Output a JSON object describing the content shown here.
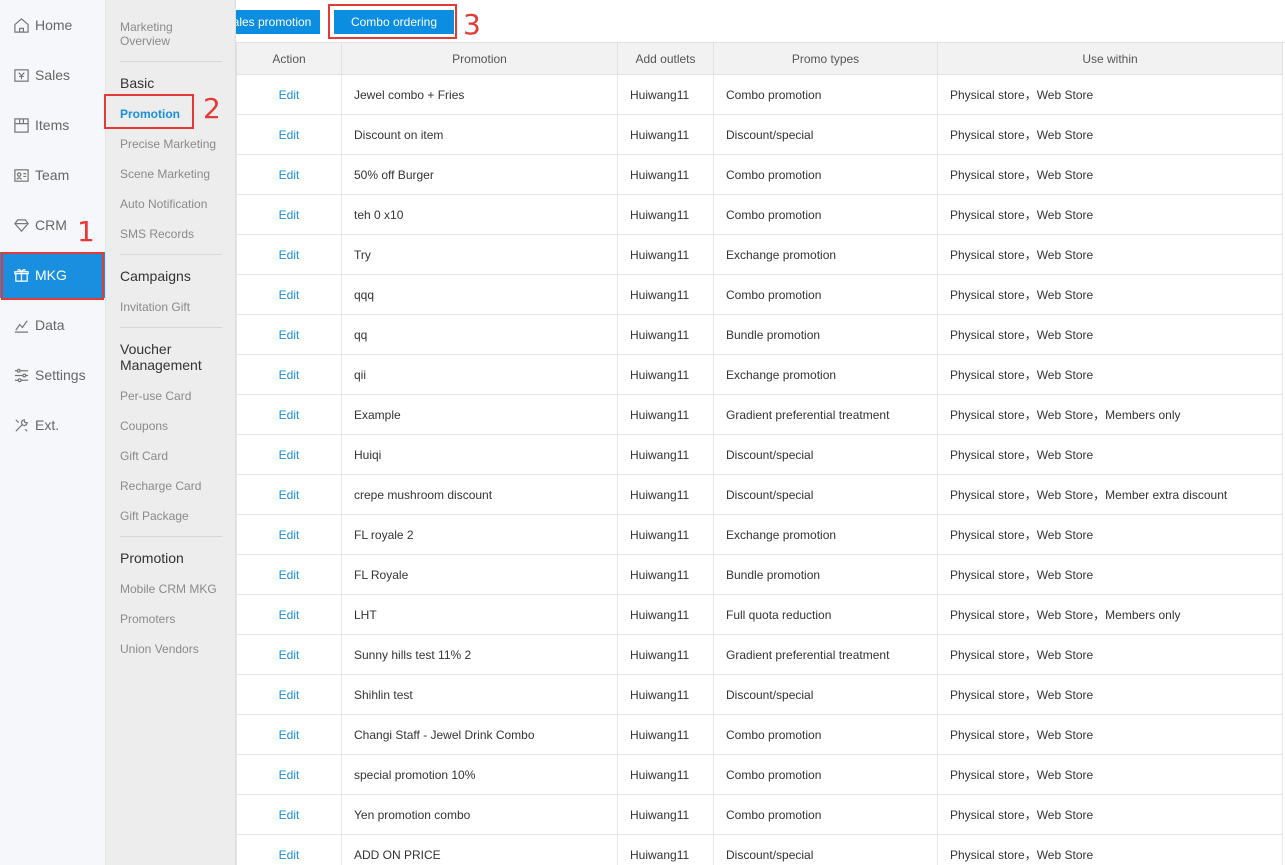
{
  "nav_primary": [
    {
      "label": "Home",
      "icon": "home-icon"
    },
    {
      "label": "Sales",
      "icon": "sales-icon"
    },
    {
      "label": "Items",
      "icon": "items-icon"
    },
    {
      "label": "Team",
      "icon": "team-icon"
    },
    {
      "label": "CRM",
      "icon": "crm-icon"
    },
    {
      "label": "MKG",
      "icon": "mkg-icon",
      "active": true
    },
    {
      "label": "Data",
      "icon": "data-icon"
    },
    {
      "label": "Settings",
      "icon": "settings-icon"
    },
    {
      "label": "Ext.",
      "icon": "ext-icon"
    }
  ],
  "nav_secondary": {
    "overview_line1": "Marketing",
    "overview_line2": "Overview",
    "basic": {
      "heading": "Basic",
      "items": [
        "Promotion",
        "Precise Marketing",
        "Scene Marketing",
        "Auto Notification",
        "SMS Records"
      ]
    },
    "campaigns": {
      "heading": "Campaigns",
      "items": [
        "Invitation Gift"
      ]
    },
    "voucher": {
      "heading_line1": "Voucher",
      "heading_line2": "Management",
      "items": [
        "Per-use Card",
        "Coupons",
        "Gift Card",
        "Recharge Card",
        "Gift Package"
      ]
    },
    "promotion": {
      "heading": "Promotion",
      "items": [
        "Mobile CRM MKG",
        "Promoters",
        "Union Vendors"
      ]
    }
  },
  "annotations": [
    "1",
    "2",
    "3"
  ],
  "tabs": {
    "sales": "ales promotion",
    "combo": "Combo ordering"
  },
  "table": {
    "headers": [
      "Action",
      "Promotion",
      "Add outlets",
      "Promo types",
      "Use within"
    ],
    "rows": [
      [
        "Edit",
        "Jewel combo + Fries",
        "Huiwang11",
        "Combo promotion",
        "Physical store，Web Store"
      ],
      [
        "Edit",
        "Discount on item",
        "Huiwang11",
        "Discount/special",
        "Physical store，Web Store"
      ],
      [
        "Edit",
        "50% off Burger",
        "Huiwang11",
        "Combo promotion",
        "Physical store，Web Store"
      ],
      [
        "Edit",
        "teh 0 x10",
        "Huiwang11",
        "Combo promotion",
        "Physical store，Web Store"
      ],
      [
        "Edit",
        "Try",
        "Huiwang11",
        "Exchange promotion",
        "Physical store，Web Store"
      ],
      [
        "Edit",
        "qqq",
        "Huiwang11",
        "Combo promotion",
        "Physical store，Web Store"
      ],
      [
        "Edit",
        "qq",
        "Huiwang11",
        "Bundle promotion",
        "Physical store，Web Store"
      ],
      [
        "Edit",
        "qii",
        "Huiwang11",
        "Exchange promotion",
        "Physical store，Web Store"
      ],
      [
        "Edit",
        "Example",
        "Huiwang11",
        "Gradient preferential treatment",
        "Physical store，Web Store，Members only"
      ],
      [
        "Edit",
        "Huiqi",
        "Huiwang11",
        "Discount/special",
        "Physical store，Web Store"
      ],
      [
        "Edit",
        "crepe mushroom discount",
        "Huiwang11",
        "Discount/special",
        "Physical store，Web Store，Member extra discount"
      ],
      [
        "Edit",
        "FL royale 2",
        "Huiwang11",
        "Exchange promotion",
        "Physical store，Web Store"
      ],
      [
        "Edit",
        "FL Royale",
        "Huiwang11",
        "Bundle promotion",
        "Physical store，Web Store"
      ],
      [
        "Edit",
        "LHT",
        "Huiwang11",
        "Full quota reduction",
        "Physical store，Web Store，Members only"
      ],
      [
        "Edit",
        "Sunny hills test 11% 2",
        "Huiwang11",
        "Gradient preferential treatment",
        "Physical store，Web Store"
      ],
      [
        "Edit",
        "Shihlin test",
        "Huiwang11",
        "Discount/special",
        "Physical store，Web Store"
      ],
      [
        "Edit",
        "Changi Staff - Jewel Drink Combo",
        "Huiwang11",
        "Combo promotion",
        "Physical store，Web Store"
      ],
      [
        "Edit",
        "special promotion 10%",
        "Huiwang11",
        "Combo promotion",
        "Physical store，Web Store"
      ],
      [
        "Edit",
        "Yen promotion combo",
        "Huiwang11",
        "Combo promotion",
        "Physical store，Web Store"
      ],
      [
        "Edit",
        "ADD ON PRICE",
        "Huiwang11",
        "Discount/special",
        "Physical store，Web Store"
      ]
    ]
  },
  "colors": {
    "accent": "#1a8fe0",
    "annotation": "#e53935"
  }
}
